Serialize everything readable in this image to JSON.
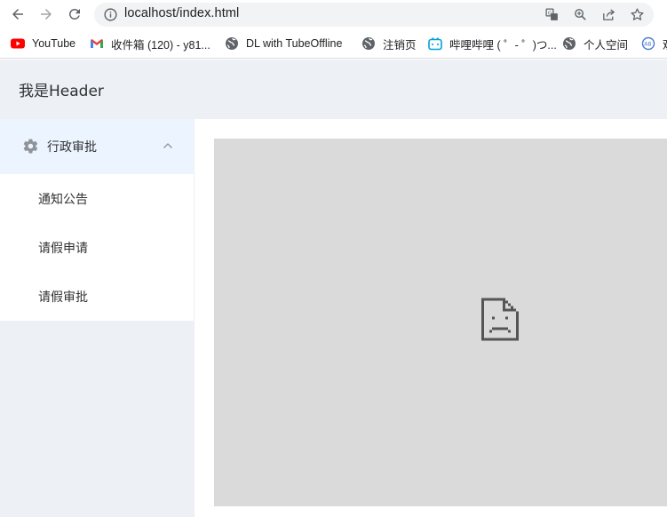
{
  "browser": {
    "url": "localhost/index.html",
    "icons": {
      "back": "back-arrow-icon",
      "forward": "forward-arrow-icon",
      "reload": "reload-icon",
      "info": "info-icon",
      "translate": "translate-icon",
      "zoom": "zoom-icon",
      "share": "share-icon",
      "bookmark": "star-icon"
    }
  },
  "bookmarks": [
    {
      "label": "YouTube",
      "icon": "youtube-icon"
    },
    {
      "label": "收件箱 (120) - y81...",
      "icon": "gmail-icon"
    },
    {
      "label": "DL with TubeOffline",
      "icon": "globe-icon"
    },
    {
      "label": "注销页",
      "icon": "globe-icon"
    },
    {
      "label": "哔哩哔哩 ( ゜- ゜)つ...",
      "icon": "bilibili-icon"
    },
    {
      "label": "个人空间",
      "icon": "globe-icon"
    },
    {
      "label": "观",
      "icon": "partial-icon"
    }
  ],
  "header": {
    "title": "我是Header"
  },
  "sidebar": {
    "submenu": {
      "label": "行政审批",
      "icon": "gear-icon",
      "expanded": true
    },
    "items": [
      {
        "label": "通知公告"
      },
      {
        "label": "请假申请"
      },
      {
        "label": "请假审批"
      }
    ]
  },
  "main": {
    "frame_icon": "broken-page-icon"
  },
  "colors": {
    "header_bg": "#edf0f5",
    "submenu_active_bg": "#ecf5ff",
    "frame_bg": "#dadada",
    "text": "#303133"
  }
}
